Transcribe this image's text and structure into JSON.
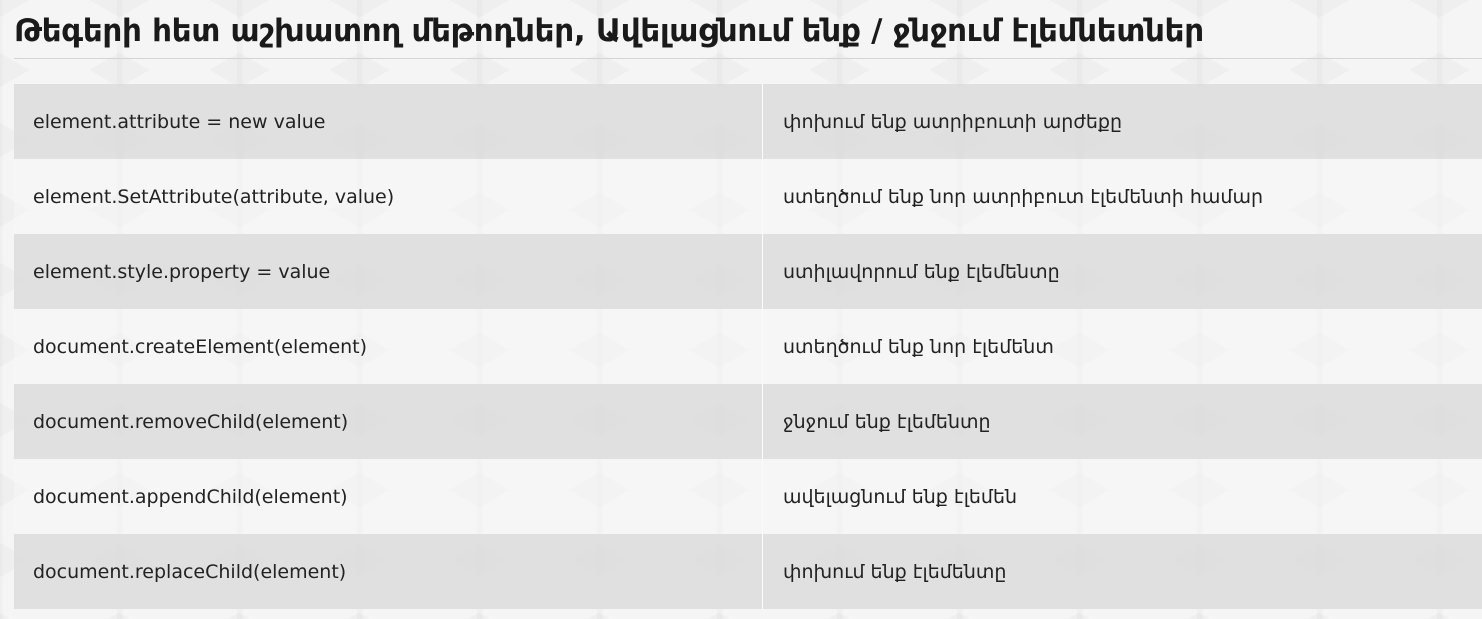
{
  "title": "Թեգերի հետ աշխատող մեթոդներ, Ավելացնում ենք / ջնջում էլեմնետներ",
  "rows": [
    {
      "code": "element.attribute = new value",
      "description": "փոխում ենք ատրիբուտի արժեքը"
    },
    {
      "code": "element.SetAttribute(attribute, value)",
      "description": "ստեղծում ենք նոր ատրիբուտ էլեմենտի համար"
    },
    {
      "code": "element.style.property = value",
      "description": "ստիլավորում ենք էլեմենտը"
    },
    {
      "code": "document.createElement(element)",
      "description": "ստեղծում ենք նոր էլեմենտ"
    },
    {
      "code": "document.removeChild(element)",
      "description": "ջնջում ենք էլեմենտը"
    },
    {
      "code": "document.appendChild(element)",
      "description": "ավելացնում ենք էլեմեն"
    },
    {
      "code": "document.replaceChild(element)",
      "description": "փոխում ենք էլեմենտը"
    }
  ],
  "colors": {
    "row_stripe": "#dcdcdc",
    "background": "#f5f5f5",
    "text": "#222222"
  }
}
